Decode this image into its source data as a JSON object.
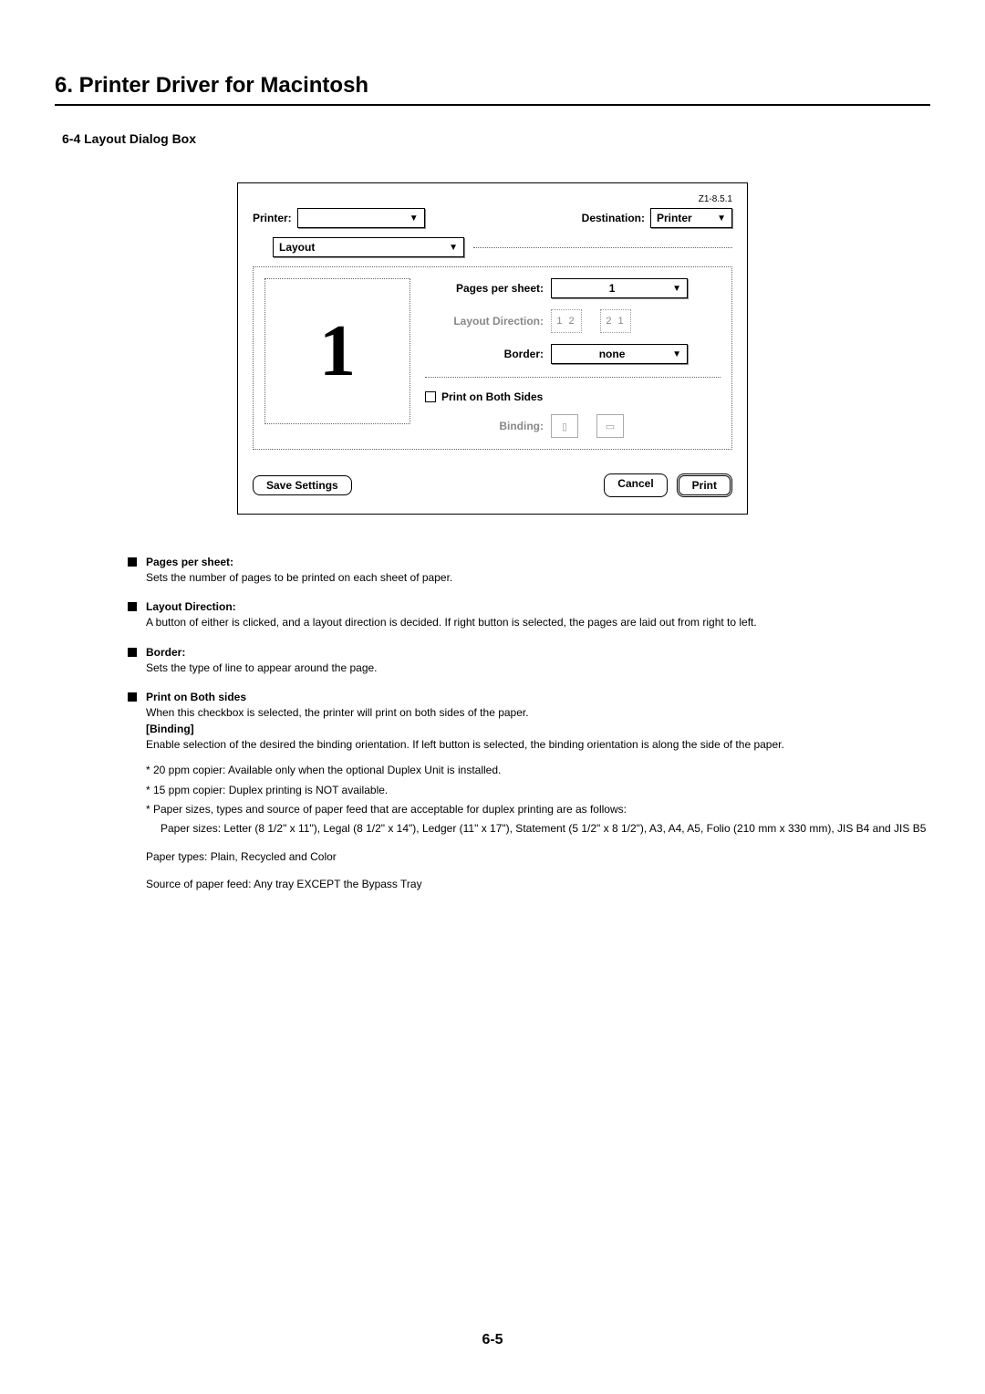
{
  "chapter_title": "6. Printer Driver for Macintosh",
  "section_title": "6-4 Layout Dialog Box",
  "dialog": {
    "version": "Z1-8.5.1",
    "printer_label": "Printer:",
    "destination_label": "Destination:",
    "destination_value": "Printer",
    "panel_value": "Layout",
    "pages_per_sheet_label": "Pages per sheet:",
    "pages_per_sheet_value": "1",
    "layout_direction_label": "Layout Direction:",
    "layout_direction_icons": [
      "1 2",
      "2 1"
    ],
    "border_label": "Border:",
    "border_value": "none",
    "print_both_sides_label": "Print on Both Sides",
    "binding_label": "Binding:",
    "preview_number": "1",
    "save_settings": "Save Settings",
    "cancel": "Cancel",
    "print": "Print"
  },
  "descriptions": [
    {
      "title": "Pages per sheet:",
      "body": "Sets the number of pages to be printed on each sheet of paper."
    },
    {
      "title": "Layout Direction:",
      "body": "A button of either is clicked, and a layout direction is decided. If right button is selected, the pages are laid out from right to left."
    },
    {
      "title": "Border:",
      "body": "Sets the type of line to appear around the page."
    },
    {
      "title": "Print on Both sides",
      "body": "When this checkbox is selected, the printer will print on both sides of the paper.",
      "sub_title": "[Binding]",
      "sub_body": "Enable selection of the desired the binding orientation. If left button is selected, the binding orientation is along the side of the paper."
    }
  ],
  "notes": {
    "n1": "* 20 ppm copier: Available only when the optional Duplex Unit is installed.",
    "n2": "* 15 ppm copier: Duplex printing is NOT available.",
    "n3": "* Paper sizes, types and source of paper feed that are acceptable for duplex printing are as follows:",
    "paper_sizes": "Paper sizes: Letter (8 1/2\" x 11\"), Legal (8 1/2\" x 14\"), Ledger (11\" x 17\"), Statement (5 1/2\" x 8 1/2\"), A3, A4, A5, Folio (210 mm x 330 mm), JIS B4 and JIS B5",
    "paper_types": "Paper types: Plain, Recycled and Color",
    "paper_source": "Source of paper feed: Any tray EXCEPT the Bypass Tray"
  },
  "page_number": "6-5"
}
